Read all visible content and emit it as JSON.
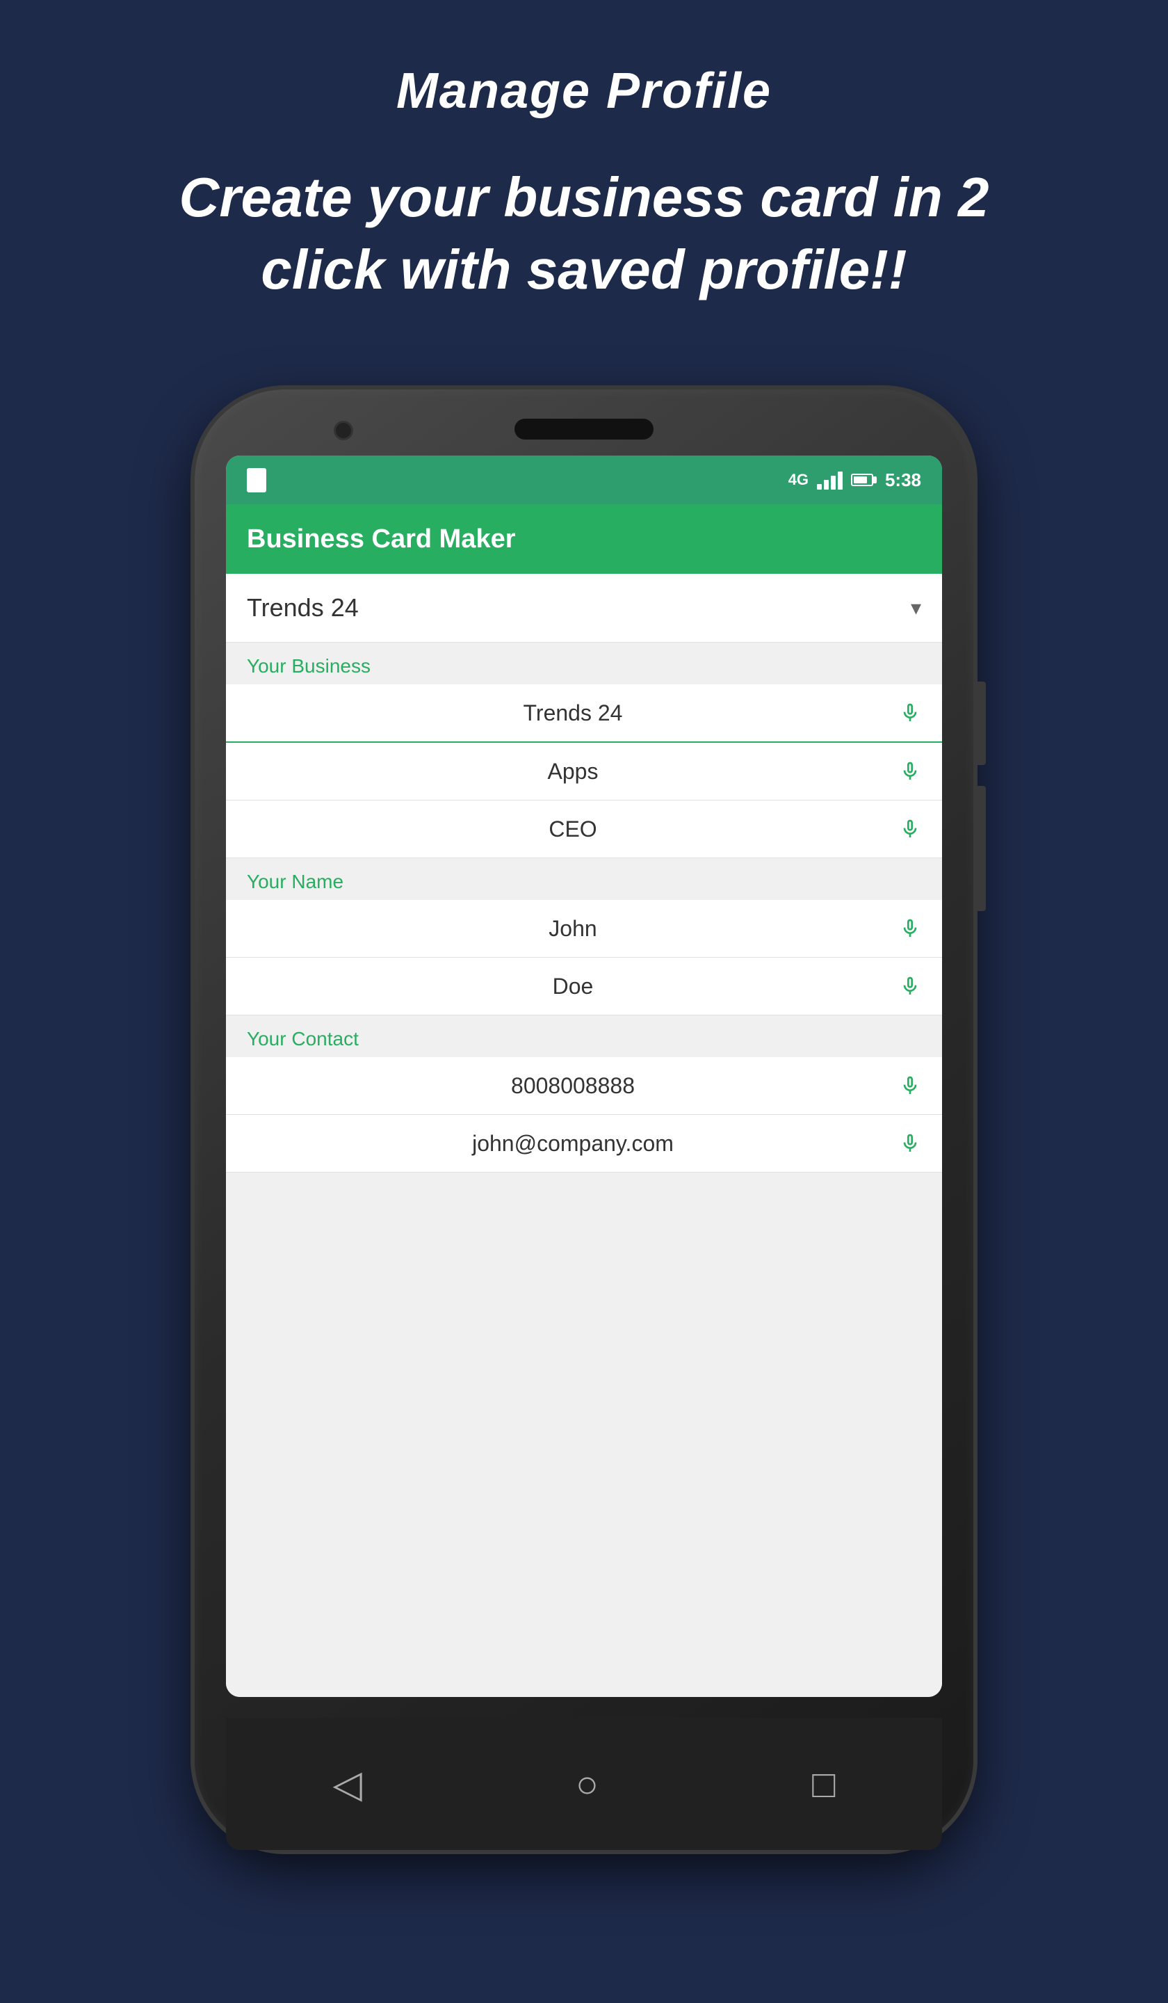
{
  "page": {
    "title": "Manage Profile",
    "subtitle": "Create your business card\nin 2 click with saved profile!!",
    "background_color": "#1e2a4a"
  },
  "phone": {
    "status_bar": {
      "time": "5:38",
      "network": "4G"
    },
    "app_header": {
      "title": "Business Card Maker"
    },
    "bottom_nav": {
      "back_icon": "◁",
      "home_icon": "○",
      "recent_icon": "□"
    }
  },
  "form": {
    "dropdown": {
      "value": "Trends 24"
    },
    "sections": [
      {
        "label": "Your Business",
        "fields": [
          {
            "value": "Trends 24",
            "active": true
          },
          {
            "value": "Apps",
            "active": false
          },
          {
            "value": "CEO",
            "active": false
          }
        ]
      },
      {
        "label": "Your Name",
        "fields": [
          {
            "value": "John",
            "active": false
          },
          {
            "value": "Doe",
            "active": false
          }
        ]
      },
      {
        "label": "Your Contact",
        "fields": [
          {
            "value": "8008008888",
            "active": false
          },
          {
            "value": "john@company.com",
            "active": false
          }
        ]
      }
    ]
  }
}
